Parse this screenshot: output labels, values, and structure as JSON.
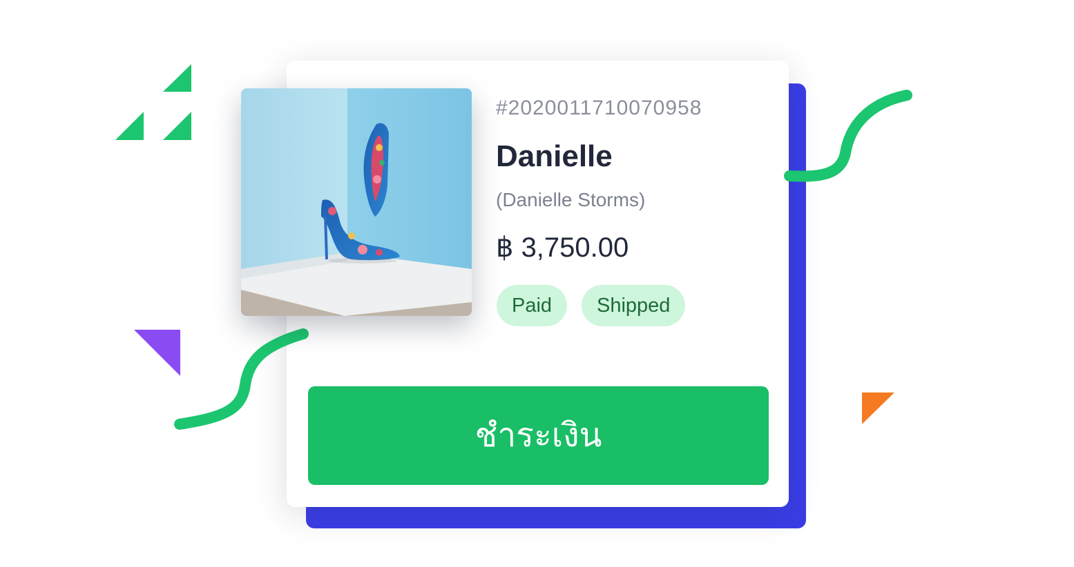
{
  "order": {
    "id": "#2020011710070958",
    "customer_name": "Danielle",
    "customer_full_name": "(Danielle Storms)",
    "price": "฿ 3,750.00",
    "badges": [
      "Paid",
      "Shipped"
    ],
    "pay_button_label": "ชำระเงิน"
  },
  "colors": {
    "accent_green": "#19be66",
    "badge_background": "#cdf6dd",
    "badge_text": "#1f6a37",
    "back_card": "#3a3de6",
    "decor_purple": "#8a4cf2",
    "decor_orange": "#f57a22"
  },
  "icons": [
    "product-image"
  ]
}
